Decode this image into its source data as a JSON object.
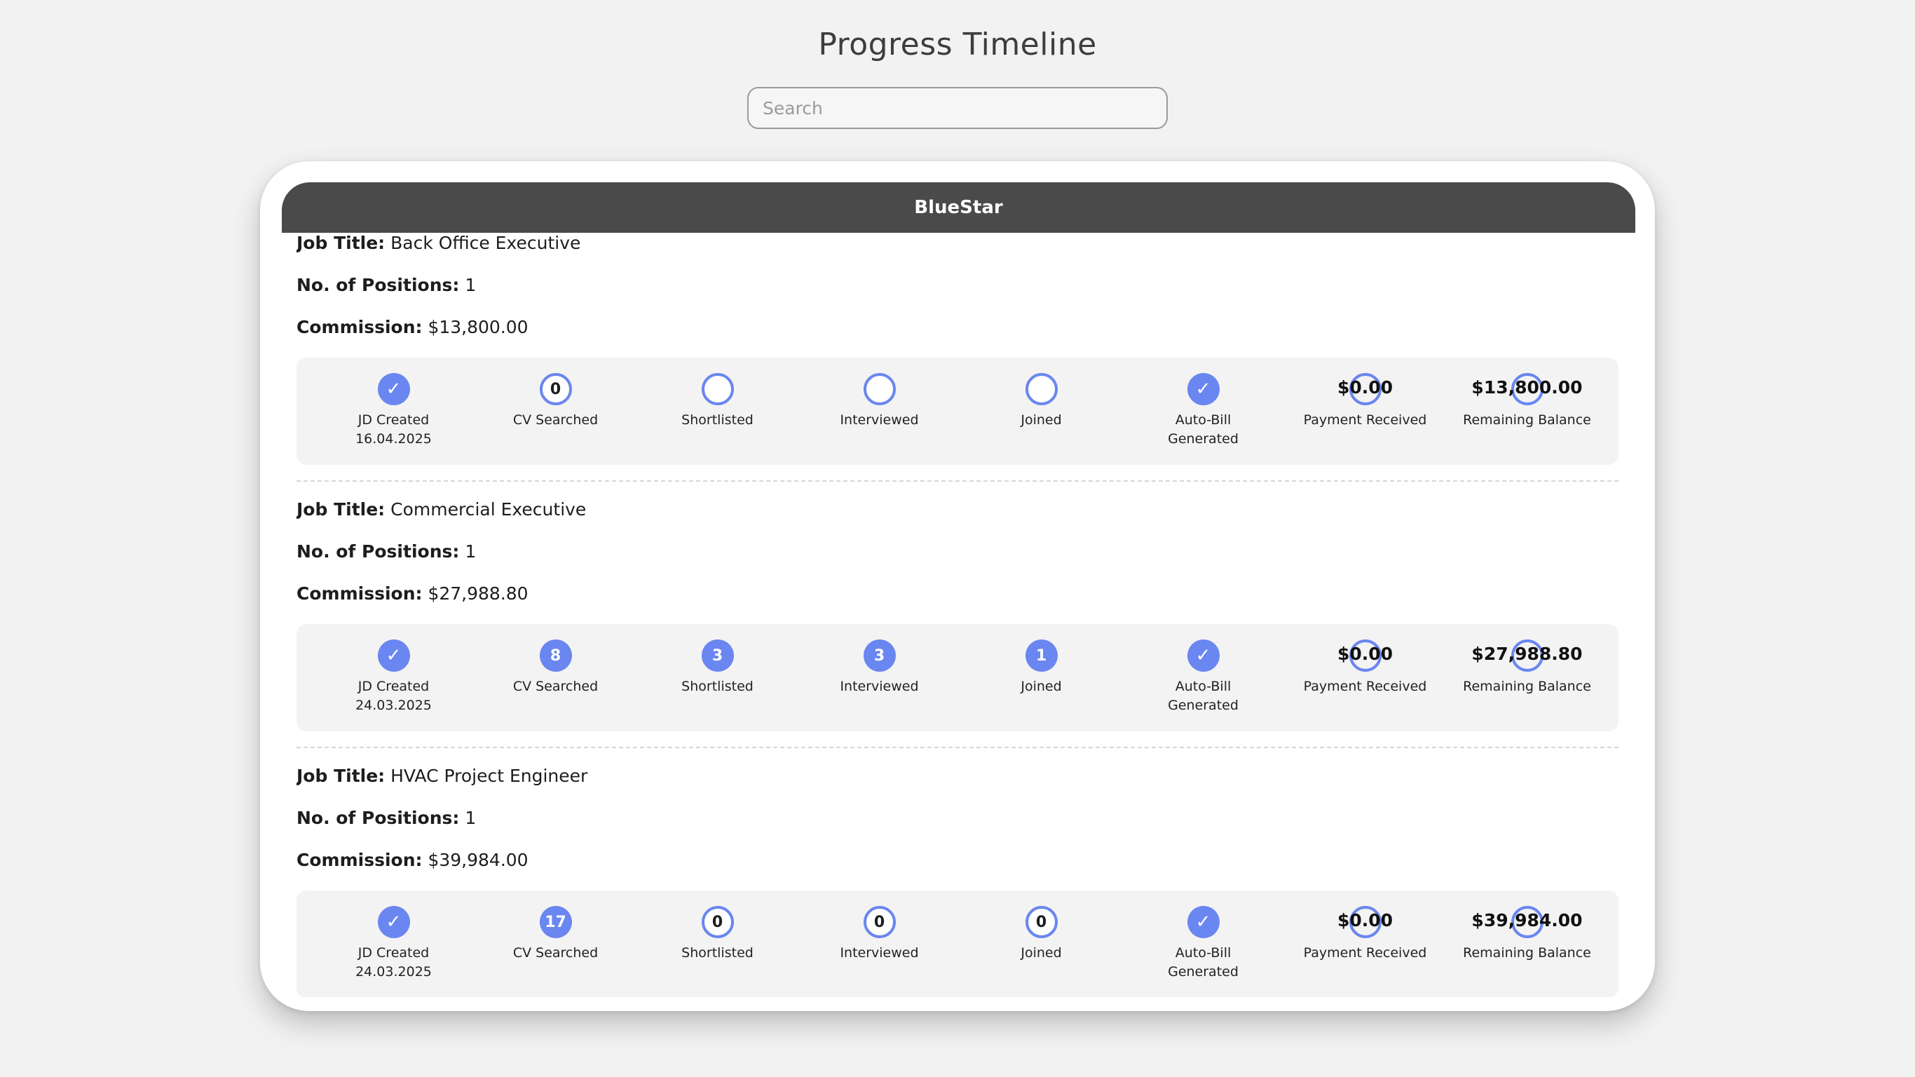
{
  "page": {
    "title": "Progress Timeline",
    "search_placeholder": "Search"
  },
  "colors": {
    "accent": "#6a86f0",
    "header_bg": "#4a4a4a",
    "page_bg": "#f2f2f2"
  },
  "client": {
    "name": "BlueStar"
  },
  "labels": {
    "job_title": "Job Title:",
    "positions": "No. of Positions:",
    "commission": "Commission:"
  },
  "jobs": [
    {
      "title": "Back Office Executive",
      "positions": "1",
      "commission": "$13,800.00",
      "steps": [
        {
          "type": "done",
          "icon": "check-icon",
          "glyph": "✓",
          "label": "JD Created",
          "sub": "16.04.2025"
        },
        {
          "type": "zero",
          "value": "0",
          "label": "CV Searched",
          "sub": ""
        },
        {
          "type": "empty",
          "value": "",
          "label": "Shortlisted",
          "sub": ""
        },
        {
          "type": "empty",
          "value": "",
          "label": "Interviewed",
          "sub": ""
        },
        {
          "type": "empty",
          "value": "",
          "label": "Joined",
          "sub": ""
        },
        {
          "type": "done",
          "icon": "check-icon",
          "glyph": "✓",
          "label": "Auto-Bill",
          "sub": "Generated"
        },
        {
          "type": "amount",
          "value": "$0.00",
          "label": "Payment Received",
          "sub": ""
        },
        {
          "type": "amount",
          "value": "$13,800.00",
          "label": "Remaining Balance",
          "sub": ""
        }
      ]
    },
    {
      "title": "Commercial Executive",
      "positions": "1",
      "commission": "$27,988.80",
      "steps": [
        {
          "type": "done",
          "icon": "check-icon",
          "glyph": "✓",
          "label": "JD Created",
          "sub": "24.03.2025"
        },
        {
          "type": "count",
          "value": "8",
          "label": "CV Searched",
          "sub": ""
        },
        {
          "type": "count",
          "value": "3",
          "label": "Shortlisted",
          "sub": ""
        },
        {
          "type": "count",
          "value": "3",
          "label": "Interviewed",
          "sub": ""
        },
        {
          "type": "count",
          "value": "1",
          "label": "Joined",
          "sub": ""
        },
        {
          "type": "done",
          "icon": "check-icon",
          "glyph": "✓",
          "label": "Auto-Bill",
          "sub": "Generated"
        },
        {
          "type": "amount",
          "value": "$0.00",
          "label": "Payment Received",
          "sub": ""
        },
        {
          "type": "amount",
          "value": "$27,988.80",
          "label": "Remaining Balance",
          "sub": ""
        }
      ]
    },
    {
      "title": "HVAC Project Engineer",
      "positions": "1",
      "commission": "$39,984.00",
      "steps": [
        {
          "type": "done",
          "icon": "check-icon",
          "glyph": "✓",
          "label": "JD Created",
          "sub": "24.03.2025"
        },
        {
          "type": "count",
          "value": "17",
          "label": "CV Searched",
          "sub": ""
        },
        {
          "type": "zero",
          "value": "0",
          "label": "Shortlisted",
          "sub": ""
        },
        {
          "type": "zero",
          "value": "0",
          "label": "Interviewed",
          "sub": ""
        },
        {
          "type": "zero",
          "value": "0",
          "label": "Joined",
          "sub": ""
        },
        {
          "type": "done",
          "icon": "check-icon",
          "glyph": "✓",
          "label": "Auto-Bill",
          "sub": "Generated"
        },
        {
          "type": "amount",
          "value": "$0.00",
          "label": "Payment Received",
          "sub": ""
        },
        {
          "type": "amount",
          "value": "$39,984.00",
          "label": "Remaining Balance",
          "sub": ""
        }
      ]
    }
  ]
}
